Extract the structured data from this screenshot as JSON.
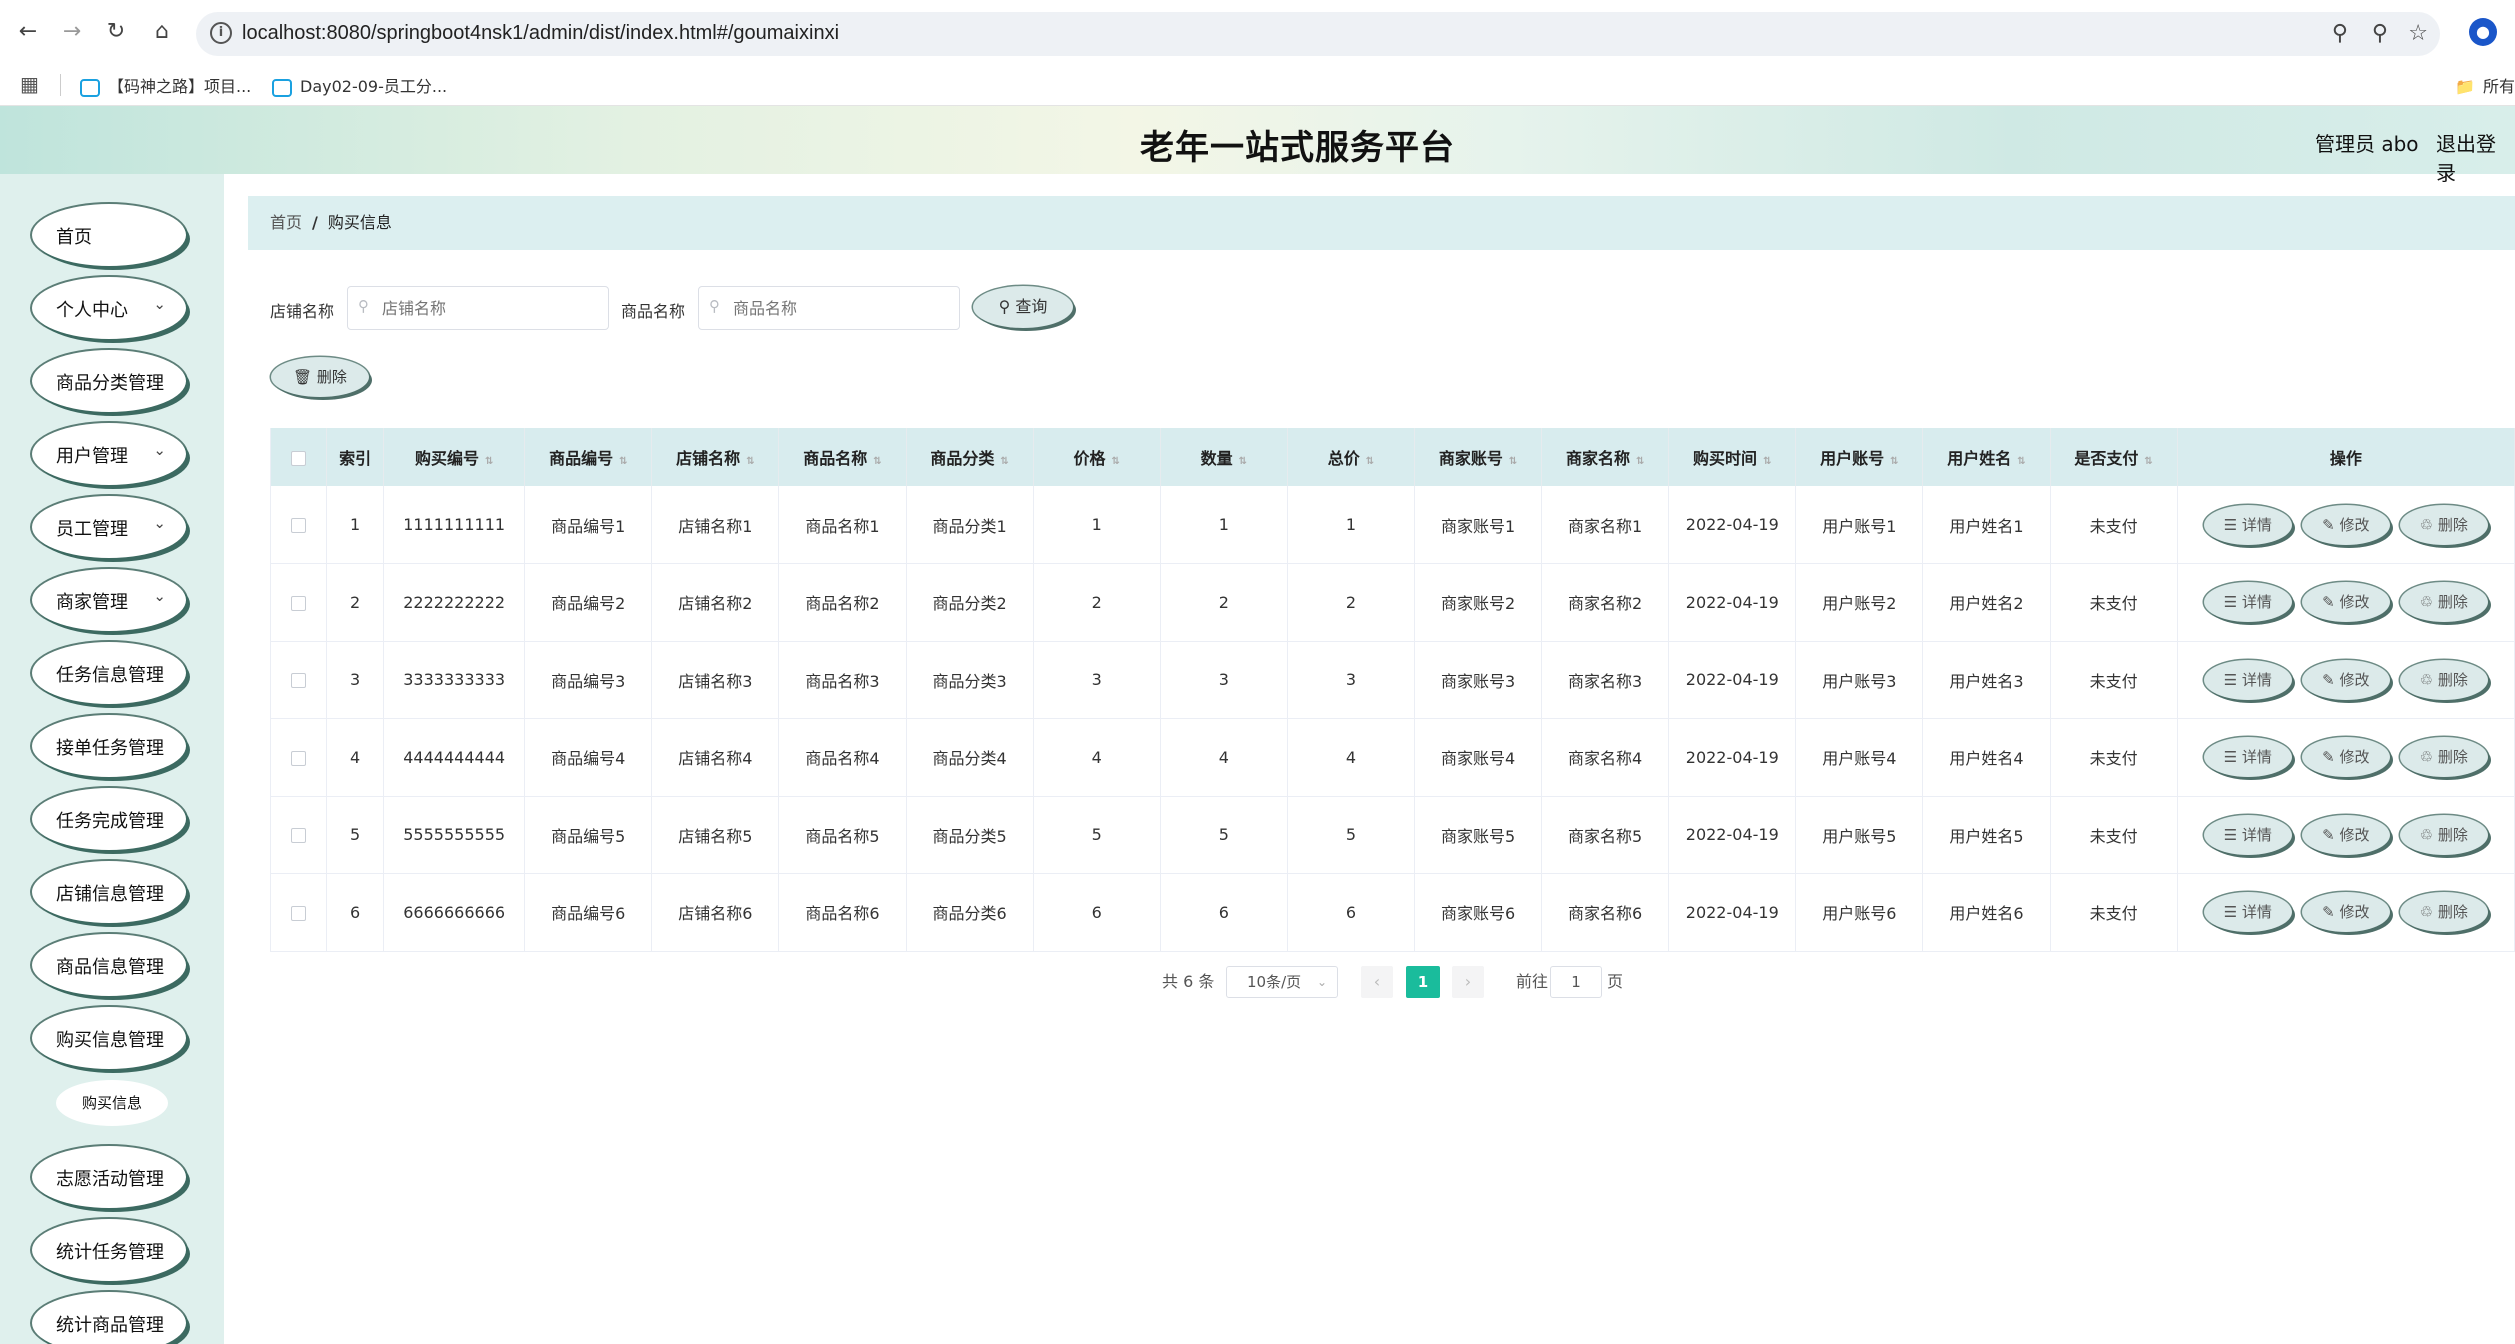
{
  "browser": {
    "url": "localhost:8080/springboot4nsk1/admin/dist/index.html#/goumaixinxi",
    "bookmarks": [
      "【码神之路】项目...",
      "Day02-09-员工分..."
    ],
    "bookmarks_right": "所有"
  },
  "header": {
    "title": "老年一站式服务平台",
    "admin": "管理员 abo",
    "logout": "退出登录"
  },
  "sidebar": {
    "items": [
      {
        "label": "首页",
        "has_arrow": false
      },
      {
        "label": "个人中心",
        "has_arrow": true
      },
      {
        "label": "商品分类管理",
        "has_arrow": false
      },
      {
        "label": "用户管理",
        "has_arrow": true
      },
      {
        "label": "员工管理",
        "has_arrow": true
      },
      {
        "label": "商家管理",
        "has_arrow": true
      },
      {
        "label": "任务信息管理",
        "has_arrow": false
      },
      {
        "label": "接单任务管理",
        "has_arrow": false
      },
      {
        "label": "任务完成管理",
        "has_arrow": false
      },
      {
        "label": "店铺信息管理",
        "has_arrow": false
      },
      {
        "label": "商品信息管理",
        "has_arrow": false
      },
      {
        "label": "购买信息管理",
        "has_arrow": false
      },
      {
        "label": "志愿活动管理",
        "has_arrow": false
      },
      {
        "label": "统计任务管理",
        "has_arrow": false
      },
      {
        "label": "统计商品管理",
        "has_arrow": false
      }
    ],
    "sub_item": "购买信息"
  },
  "breadcrumb": {
    "home": "首页",
    "separator": "/",
    "current": "购买信息"
  },
  "search": {
    "shop_label": "店铺名称",
    "shop_placeholder": "店铺名称",
    "product_label": "商品名称",
    "product_placeholder": "商品名称",
    "query_button": "查询",
    "delete_button": "删除"
  },
  "table": {
    "headers": [
      "索引",
      "购买编号",
      "商品编号",
      "店铺名称",
      "商品名称",
      "商品分类",
      "价格",
      "数量",
      "总价",
      "商家账号",
      "商家名称",
      "购买时间",
      "用户账号",
      "用户姓名",
      "是否支付",
      "操作"
    ],
    "sortable": [
      false,
      true,
      true,
      true,
      true,
      true,
      true,
      true,
      true,
      true,
      true,
      true,
      true,
      true,
      true,
      false
    ],
    "rows": [
      [
        "1",
        "1111111111",
        "商品编号1",
        "店铺名称1",
        "商品名称1",
        "商品分类1",
        "1",
        "1",
        "1",
        "商家账号1",
        "商家名称1",
        "2022-04-19",
        "用户账号1",
        "用户姓名1",
        "未支付"
      ],
      [
        "2",
        "2222222222",
        "商品编号2",
        "店铺名称2",
        "商品名称2",
        "商品分类2",
        "2",
        "2",
        "2",
        "商家账号2",
        "商家名称2",
        "2022-04-19",
        "用户账号2",
        "用户姓名2",
        "未支付"
      ],
      [
        "3",
        "3333333333",
        "商品编号3",
        "店铺名称3",
        "商品名称3",
        "商品分类3",
        "3",
        "3",
        "3",
        "商家账号3",
        "商家名称3",
        "2022-04-19",
        "用户账号3",
        "用户姓名3",
        "未支付"
      ],
      [
        "4",
        "4444444444",
        "商品编号4",
        "店铺名称4",
        "商品名称4",
        "商品分类4",
        "4",
        "4",
        "4",
        "商家账号4",
        "商家名称4",
        "2022-04-19",
        "用户账号4",
        "用户姓名4",
        "未支付"
      ],
      [
        "5",
        "5555555555",
        "商品编号5",
        "店铺名称5",
        "商品名称5",
        "商品分类5",
        "5",
        "5",
        "5",
        "商家账号5",
        "商家名称5",
        "2022-04-19",
        "用户账号5",
        "用户姓名5",
        "未支付"
      ],
      [
        "6",
        "6666666666",
        "商品编号6",
        "店铺名称6",
        "商品名称6",
        "商品分类6",
        "6",
        "6",
        "6",
        "商家账号6",
        "商家名称6",
        "2022-04-19",
        "用户账号6",
        "用户姓名6",
        "未支付"
      ]
    ],
    "actions": {
      "detail": "详情",
      "edit": "修改",
      "delete": "删除"
    }
  },
  "pagination": {
    "total": "共 6 条",
    "page_size": "10条/页",
    "current_page": "1",
    "goto_label": "前往",
    "goto_value": "1",
    "page_suffix": "页"
  },
  "colors": {
    "accent": "#1abc9c",
    "header_bg": "#d8ecee",
    "sidebar_bg": "#dff0ed"
  }
}
